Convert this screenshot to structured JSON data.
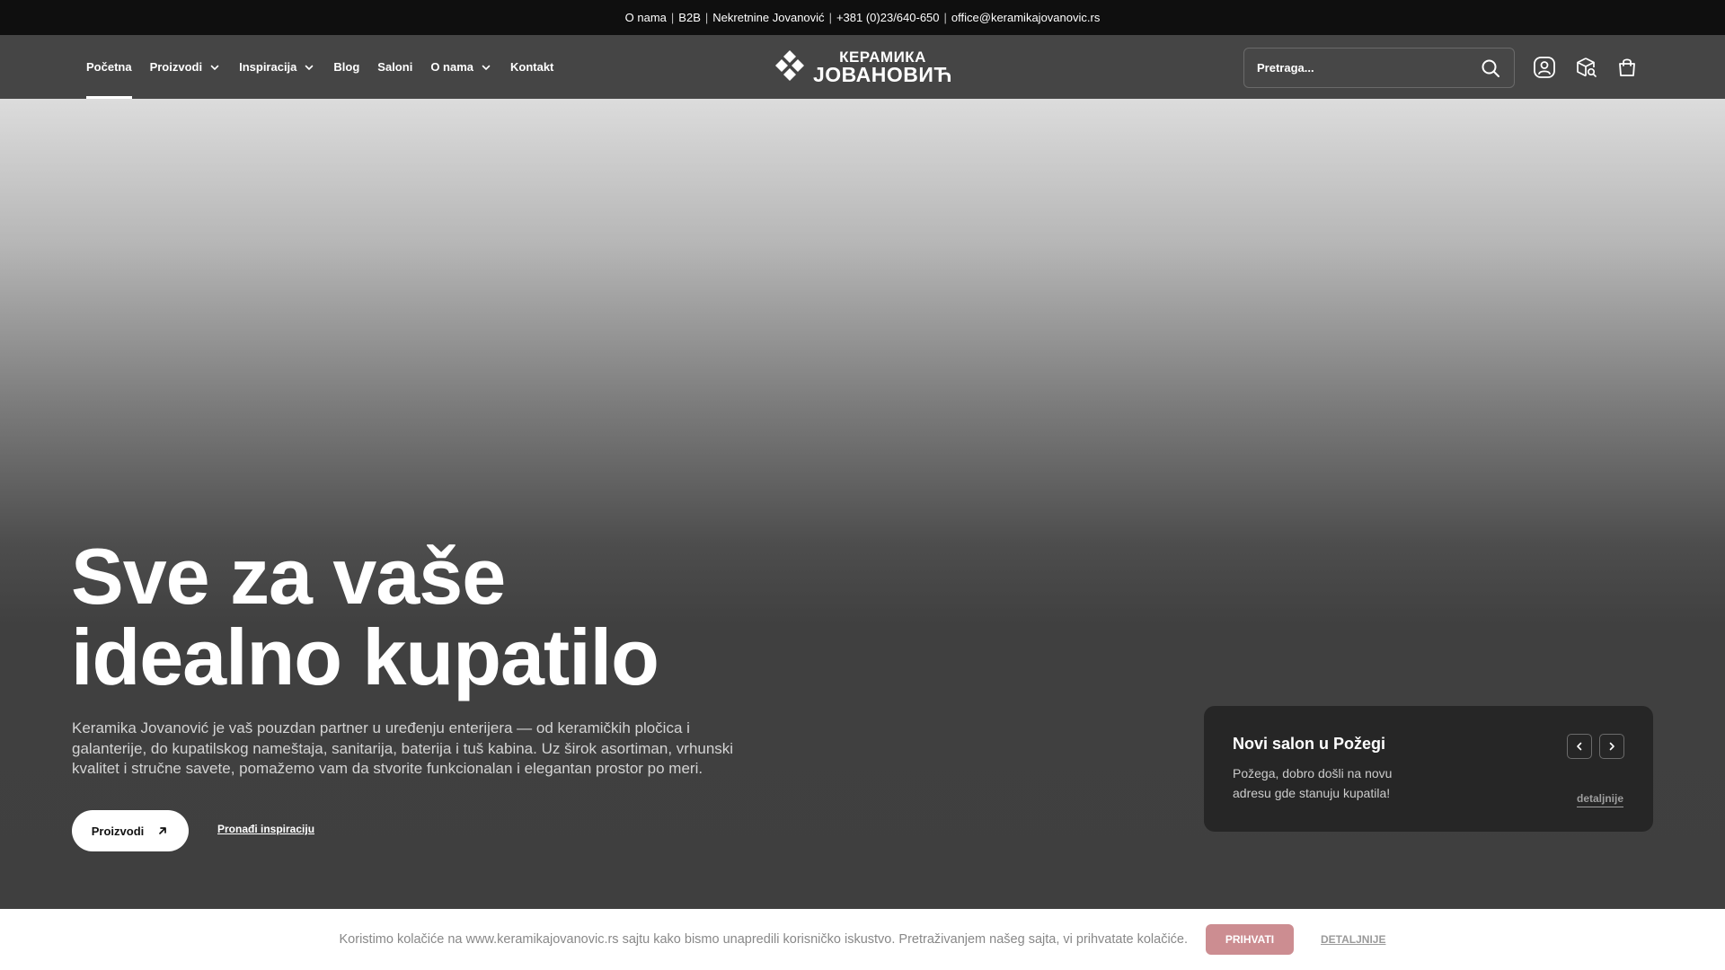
{
  "topbar": {
    "links": [
      "O nama",
      "B2B",
      "Nekretnine Jovanović",
      "+381 (0)23/640-650",
      "office@keramikajovanovic.rs"
    ]
  },
  "nav": {
    "items": [
      {
        "label": "Početna",
        "dropdown": false,
        "active": true
      },
      {
        "label": "Proizvodi",
        "dropdown": true
      },
      {
        "label": "Inspiracija",
        "dropdown": true
      },
      {
        "label": "Blog",
        "dropdown": false
      },
      {
        "label": "Saloni",
        "dropdown": false
      },
      {
        "label": "O nama",
        "dropdown": true
      },
      {
        "label": "Kontakt",
        "dropdown": false
      }
    ]
  },
  "logo": {
    "line1": "КЕРАМИКА",
    "line2": "ЈОВАНОВИЋ"
  },
  "search": {
    "placeholder": "Pretraga..."
  },
  "header_icons": [
    "user-icon",
    "order-search-icon",
    "cart-icon"
  ],
  "hero": {
    "title_line1": "Sve za vaše",
    "title_line2": "idealno kupatilo",
    "description": "Keramika Jovanović je vaš pouzdan partner u uređenju enterijera — od keramičkih pločica i galanterije, do kupatilskog nameštaja, sanitarija, baterija i tuš kabina. Uz širok asortiman, vrhunski kvalitet i stručne savete, pomažemo vam da stvorite funkcionalan i elegantan prostor po meri.",
    "primary_button": "Proizvodi",
    "secondary_link": "Pronađi inspiraciju"
  },
  "news_card": {
    "title": "Novi salon u Požegi",
    "text": "Požega, dobro došli na novu adresu gde stanuju kupatila!",
    "link": "detaljnije"
  },
  "cookie": {
    "text": "Koristimo kolačiće na www.keramikajovanovic.rs sajtu kako bismo unapredili korisničko iskustvo. Pretraživanjem našeg sajta, vi prihvatate kolačiće.",
    "accept": "PRIHVATI",
    "details": "DETALJNIJE"
  },
  "colors": {
    "topbar_bg": "#0f0f0f",
    "header_bg": "#454545",
    "card_bg": "#262626",
    "cookie_accept_bg": "#cc8d91"
  }
}
